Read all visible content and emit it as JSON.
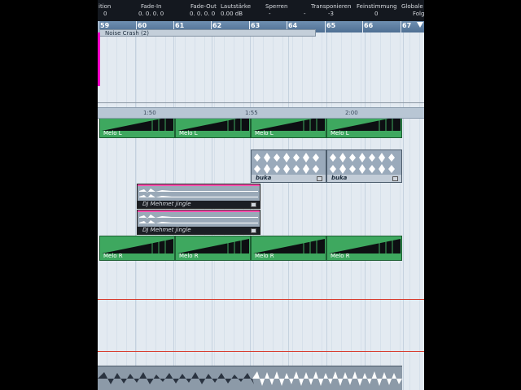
{
  "infobar": {
    "headers": [
      "ition",
      "Fade-In",
      "Fade-Out",
      "Lautstärke",
      "Sperren",
      "Transponieren",
      "Feinstimmung",
      "Globale"
    ],
    "values": [
      "0",
      "0. 0. 0. 0",
      "0. 0. 0. 0",
      "0.00 dB",
      "-",
      "-",
      "-3",
      "0",
      "Folg"
    ]
  },
  "ruler": {
    "bars": [
      "59",
      "60",
      "61",
      "62",
      "63",
      "64",
      "65",
      "66",
      "67"
    ]
  },
  "noise_clip": {
    "label": "Noise Crash (2)"
  },
  "melo_l": {
    "labels": [
      "Melo L",
      "Melo L",
      "Melo L",
      "Melo L"
    ]
  },
  "subruler": {
    "labels": [
      "1:50",
      "1:55",
      "2:00"
    ]
  },
  "buka": {
    "labels": [
      "buka",
      "buka"
    ]
  },
  "dj": {
    "labels": [
      "DJ Mehmet jingle",
      "DJ Mehmet jingle"
    ]
  },
  "melo_r": {
    "labels": [
      "Melo R",
      "Melo R",
      "Melo R",
      "Melo R"
    ]
  },
  "colors": {
    "clip_green": "#3ea85f",
    "marker_line": "#d8382a",
    "cursor": "#ff00cc"
  }
}
